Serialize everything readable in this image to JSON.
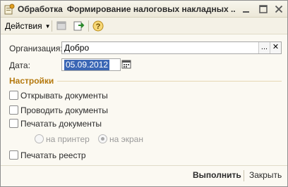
{
  "window": {
    "title_part1": "Обработка",
    "title_part2": "Формирование налоговых накладных ..."
  },
  "toolbar": {
    "actions_label": "Действия",
    "icons": [
      "window-icon",
      "export-icon",
      "help-icon"
    ]
  },
  "form": {
    "org_label": "Организация:",
    "org_value": "Добро",
    "org_select_btn": "...",
    "org_clear_btn": "✕",
    "date_label": "Дата:",
    "date_value": "05.09.2012"
  },
  "settings": {
    "title": "Настройки",
    "open_docs": "Открывать документы",
    "post_docs": "Проводить документы",
    "print_docs": "Печатать документы",
    "to_printer": "на принтер",
    "to_screen": "на экран",
    "print_register": "Печатать реестр"
  },
  "footer": {
    "run_label": "Выполнить",
    "close_label": "Закрыть"
  },
  "colors": {
    "accent": "#b5790e",
    "selection": "#3a66b5"
  }
}
